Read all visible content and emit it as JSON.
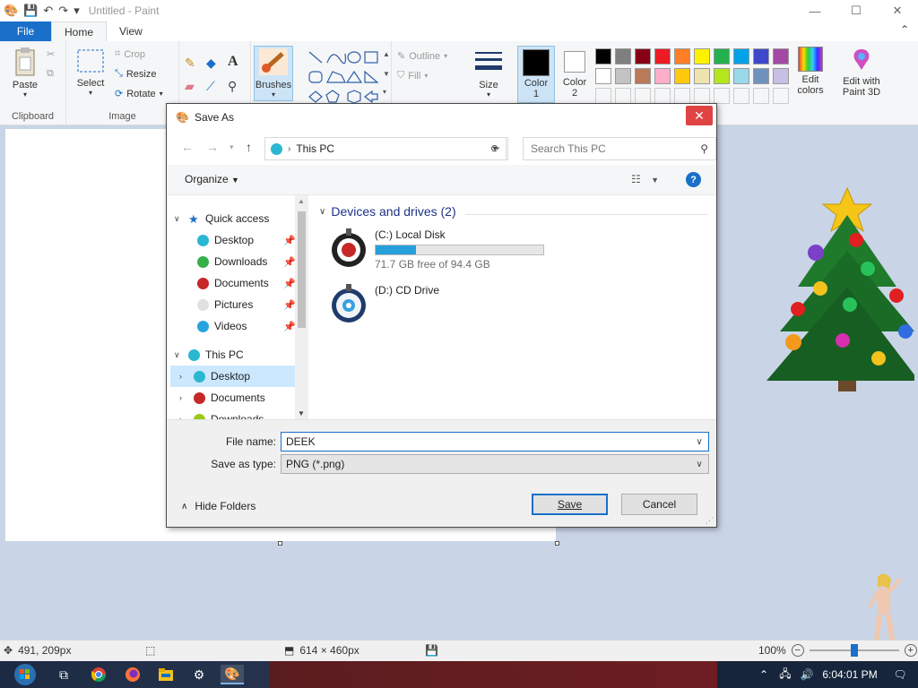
{
  "app": {
    "title": "Untitled - Paint",
    "menu_tabs": {
      "file": "File",
      "home": "Home",
      "view": "View"
    }
  },
  "ribbon": {
    "clipboard": {
      "group_label": "Clipboard",
      "paste": "Paste",
      "cut_icon": "scissors-icon",
      "copy_icon": "copy-icon"
    },
    "image": {
      "group_label": "Image",
      "select": "Select",
      "crop": "Crop",
      "resize": "Resize",
      "rotate": "Rotate"
    },
    "tools": {
      "icons": [
        "pencil-icon",
        "fill-icon",
        "text-icon",
        "eraser-icon",
        "color-picker-icon",
        "magnifier-icon"
      ]
    },
    "brushes": "Brushes",
    "shapes": {
      "outline": "Outline",
      "fill": "Fill"
    },
    "size": "Size",
    "color1": {
      "label": "Color",
      "sub": "1",
      "color": "#000000"
    },
    "color2": {
      "label": "Color",
      "sub": "2",
      "color": "#ffffff"
    },
    "palette": [
      "#000000",
      "#7f7f7f",
      "#880015",
      "#ed1c24",
      "#ff7f27",
      "#fff200",
      "#22b14c",
      "#00a2e8",
      "#3f48cc",
      "#a349a4",
      "#ffffff",
      "#c3c3c3",
      "#b97a57",
      "#ffaec9",
      "#ffc90e",
      "#efe4b0",
      "#b5e61d",
      "#99d9ea",
      "#7092be",
      "#c8bfe7"
    ],
    "edit_colors": "Edit colors",
    "edit_paint3d": "Edit with Paint 3D"
  },
  "statusbar": {
    "cursor_pos": "491, 209px",
    "canvas_size": "614 × 460px",
    "zoom": "100%",
    "zoom_fraction": 0.5
  },
  "taskbar": {
    "clock": "6:04:01 PM",
    "apps": [
      "start-orb-icon",
      "task-view-icon",
      "chrome-icon",
      "firefox-icon",
      "file-explorer-icon",
      "settings-icon",
      "paint-icon"
    ]
  },
  "dialog": {
    "title": "Save As",
    "address": "This PC",
    "search_placeholder": "Search This PC",
    "organize": "Organize",
    "nav": {
      "quick_access": "Quick access",
      "quick_items": [
        {
          "label": "Desktop",
          "color": "#2ab7d1"
        },
        {
          "label": "Downloads",
          "color": "#36b04a"
        },
        {
          "label": "Documents",
          "color": "#c62828"
        },
        {
          "label": "Pictures",
          "color": "#e0e0e0"
        },
        {
          "label": "Videos",
          "color": "#29a3e0"
        }
      ],
      "this_pc": "This PC",
      "pc_items": [
        {
          "label": "Desktop",
          "color": "#2ab7d1"
        },
        {
          "label": "Documents",
          "color": "#c62828"
        },
        {
          "label": "Downloads",
          "color": "#9cc81a"
        }
      ]
    },
    "group_header": "Devices and drives (2)",
    "drives": [
      {
        "name": "(C:) Local Disk",
        "free_text": "71.7 GB free of 94.4 GB",
        "used_fraction": 0.24
      },
      {
        "name": "(D:) CD Drive"
      }
    ],
    "file_name_label": "File name:",
    "file_name": "DEEK",
    "save_type_label": "Save as type:",
    "save_type": "PNG (*.png)",
    "hide_folders": "Hide Folders",
    "save_button": "Save",
    "cancel_button": "Cancel"
  }
}
